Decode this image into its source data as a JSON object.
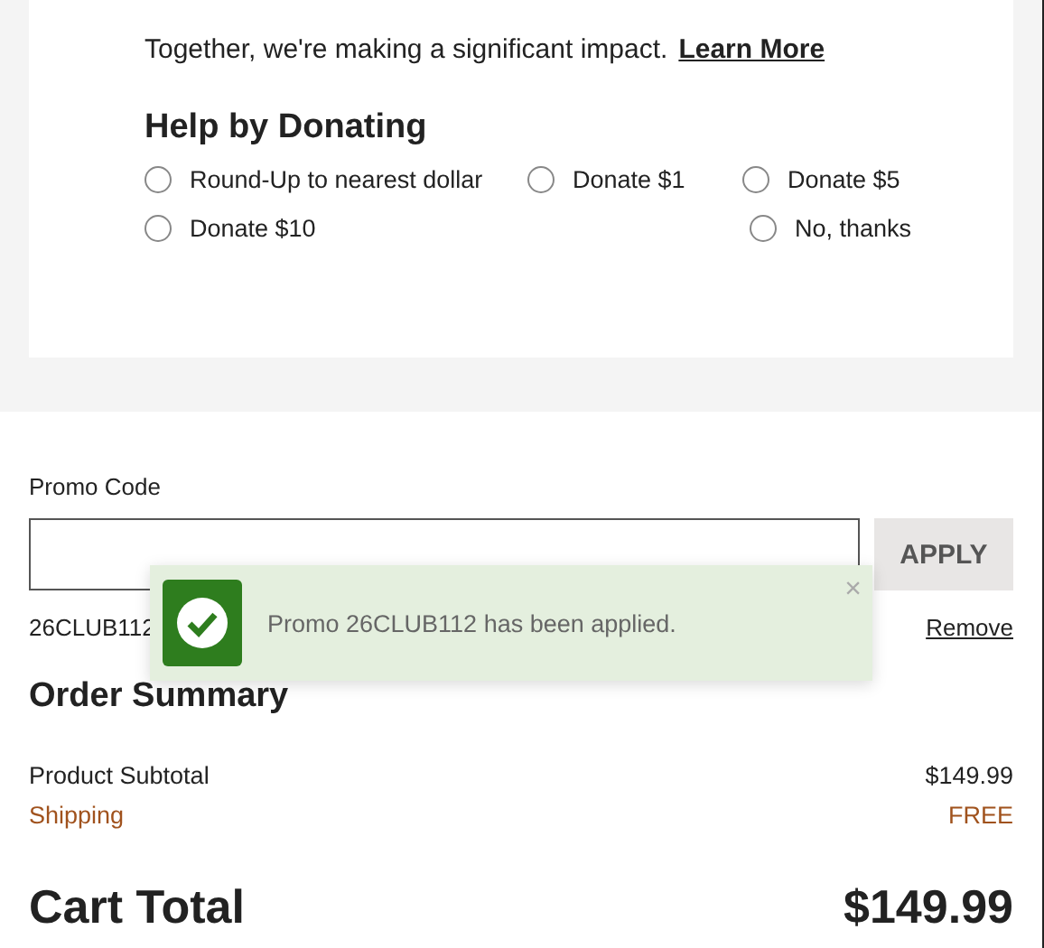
{
  "intro": {
    "text": "Together, we're making a significant impact.",
    "link": "Learn More"
  },
  "donate": {
    "title": "Help by Donating",
    "options": [
      {
        "label": "Round-Up to nearest dollar",
        "selected": false
      },
      {
        "label": "Donate $1",
        "selected": false
      },
      {
        "label": "Donate $5",
        "selected": false
      },
      {
        "label": "Donate $10",
        "selected": false
      },
      {
        "label": "No, thanks",
        "selected": false
      }
    ]
  },
  "promo": {
    "label": "Promo Code",
    "button": "APPLY",
    "applied_code": "26CLUB112",
    "remove": "Remove"
  },
  "toast": {
    "message": "Promo 26CLUB112 has been applied.",
    "close": "×"
  },
  "summary": {
    "title": "Order Summary",
    "rows": [
      {
        "label": "Product Subtotal",
        "value": "$149.99",
        "kind": "plain"
      },
      {
        "label": "Shipping",
        "value": "FREE",
        "kind": "highlight"
      }
    ],
    "total_label": "Cart Total",
    "total_value": "$149.99"
  }
}
